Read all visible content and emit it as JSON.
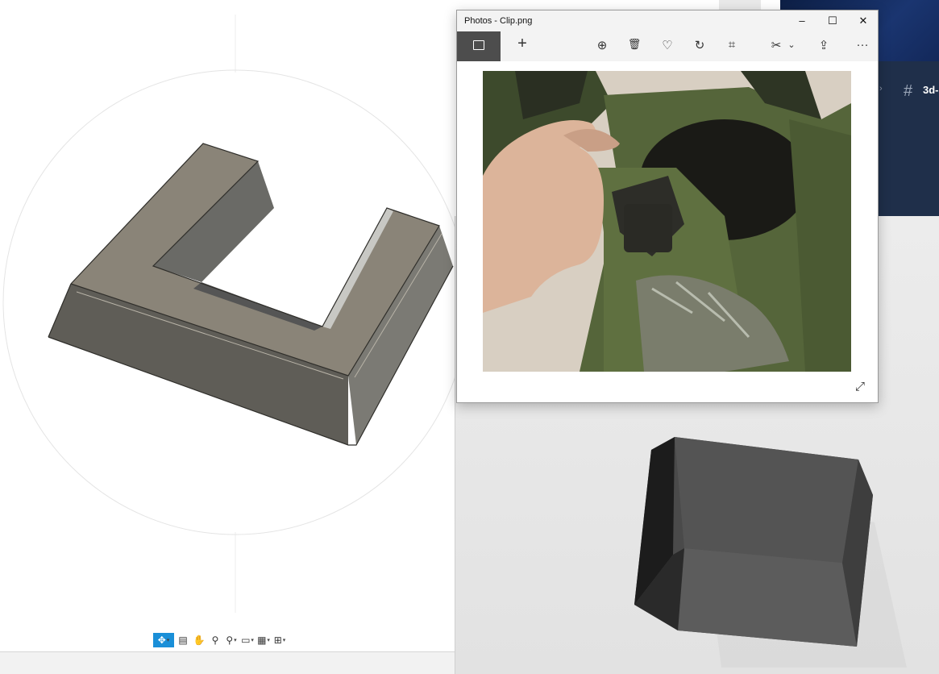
{
  "photos": {
    "title": "Photos - Clip.png",
    "window_controls": {
      "minimize": "–",
      "maximize": "☐",
      "close": "✕"
    },
    "toolbar": {
      "add": "+",
      "zoom": "⊕",
      "delete": "🗑",
      "favorite": "♡",
      "rotate": "↻",
      "crop": "⌗",
      "edit": "✂",
      "edit_caret": "⌄",
      "share": "⇪",
      "more": "···"
    },
    "expand": "⤢"
  },
  "background_app": {
    "channel_hash": "#",
    "channel_name": "3d-",
    "chevron": "›"
  },
  "cad_toolbar": {
    "icons": [
      "orbit-icon",
      "look-at-icon",
      "pan-icon",
      "zoom-icon",
      "fit-icon",
      "display-settings-icon",
      "grid-icon",
      "viewports-icon"
    ],
    "glyphs": {
      "orbit": "✥",
      "look": "▤",
      "pan": "✋",
      "zoom": "⚲",
      "fit": "⚲",
      "display": "▭",
      "grid": "▦",
      "viewports": "⊞",
      "caret": "▾"
    }
  },
  "colors": {
    "accent": "#1a8fd8",
    "cad_model": "#6f6b62",
    "viewer_model": "#4a4a4a"
  }
}
